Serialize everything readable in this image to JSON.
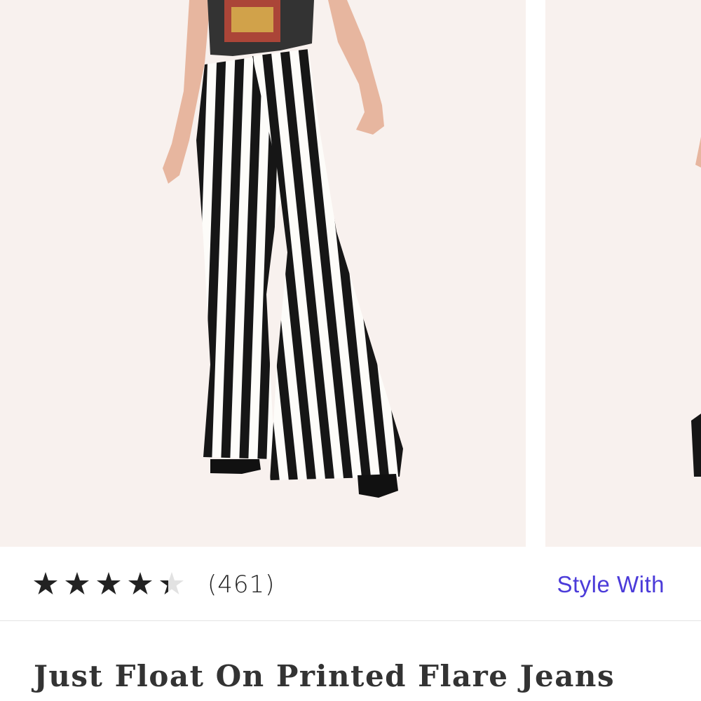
{
  "gallery": {
    "images": [
      {
        "name": "model wearing striped flare jeans, front view"
      },
      {
        "name": "model wearing striped flare jeans, partial second view"
      }
    ],
    "background_color": "#f8f1ee"
  },
  "rating": {
    "stars_value": 4.5,
    "stars_max": 5,
    "review_count": "(461)",
    "star_color": "#222222"
  },
  "actions": {
    "style_with_label": "Style With",
    "accent_color": "#4b3bd9"
  },
  "product": {
    "title": "Just Float On Printed Flare Jeans"
  }
}
